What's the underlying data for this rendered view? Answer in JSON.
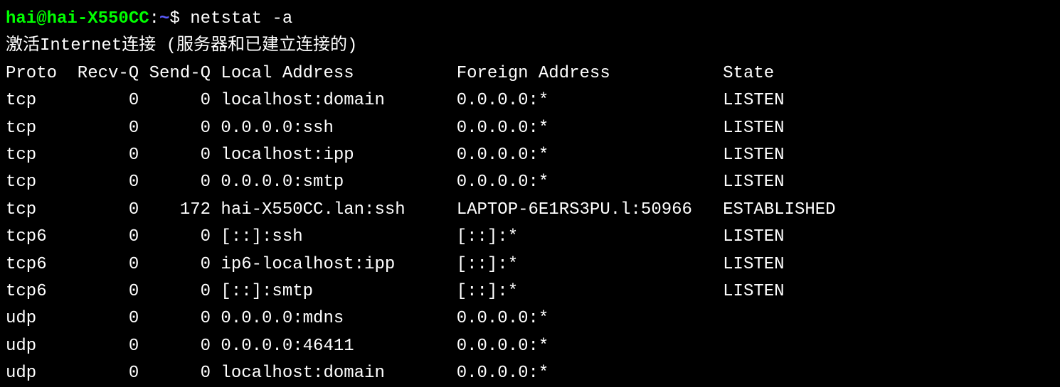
{
  "prompt": {
    "user_host": "hai@hai-X550CC",
    "colon": ":",
    "path": "~",
    "symbol": "$",
    "command": "netstat -a"
  },
  "header_line": "激活Internet连接 (服务器和已建立连接的)",
  "columns": {
    "proto": "Proto",
    "recvq": "Recv-Q",
    "sendq": "Send-Q",
    "local": "Local Address",
    "foreign": "Foreign Address",
    "state": "State"
  },
  "rows": [
    {
      "proto": "tcp",
      "recvq": "0",
      "sendq": "0",
      "local": "localhost:domain",
      "foreign": "0.0.0.0:*",
      "state": "LISTEN"
    },
    {
      "proto": "tcp",
      "recvq": "0",
      "sendq": "0",
      "local": "0.0.0.0:ssh",
      "foreign": "0.0.0.0:*",
      "state": "LISTEN"
    },
    {
      "proto": "tcp",
      "recvq": "0",
      "sendq": "0",
      "local": "localhost:ipp",
      "foreign": "0.0.0.0:*",
      "state": "LISTEN"
    },
    {
      "proto": "tcp",
      "recvq": "0",
      "sendq": "0",
      "local": "0.0.0.0:smtp",
      "foreign": "0.0.0.0:*",
      "state": "LISTEN"
    },
    {
      "proto": "tcp",
      "recvq": "0",
      "sendq": "172",
      "local": "hai-X550CC.lan:ssh",
      "foreign": "LAPTOP-6E1RS3PU.l:50966",
      "state": "ESTABLISHED"
    },
    {
      "proto": "tcp6",
      "recvq": "0",
      "sendq": "0",
      "local": "[::]:ssh",
      "foreign": "[::]:*",
      "state": "LISTEN"
    },
    {
      "proto": "tcp6",
      "recvq": "0",
      "sendq": "0",
      "local": "ip6-localhost:ipp",
      "foreign": "[::]:*",
      "state": "LISTEN"
    },
    {
      "proto": "tcp6",
      "recvq": "0",
      "sendq": "0",
      "local": "[::]:smtp",
      "foreign": "[::]:*",
      "state": "LISTEN"
    },
    {
      "proto": "udp",
      "recvq": "0",
      "sendq": "0",
      "local": "0.0.0.0:mdns",
      "foreign": "0.0.0.0:*",
      "state": ""
    },
    {
      "proto": "udp",
      "recvq": "0",
      "sendq": "0",
      "local": "0.0.0.0:46411",
      "foreign": "0.0.0.0:*",
      "state": ""
    },
    {
      "proto": "udp",
      "recvq": "0",
      "sendq": "0",
      "local": "localhost:domain",
      "foreign": "0.0.0.0:*",
      "state": ""
    }
  ]
}
